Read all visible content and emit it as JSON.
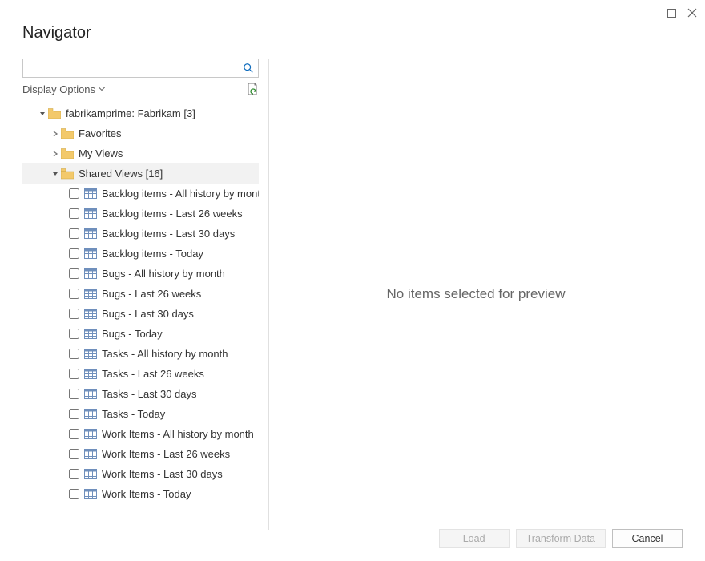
{
  "window": {
    "title": "Navigator"
  },
  "search": {
    "placeholder": ""
  },
  "options": {
    "display_label": "Display Options"
  },
  "tree": {
    "root": {
      "label": "fabrikamprime: Fabrikam [3]"
    },
    "favorites": {
      "label": "Favorites"
    },
    "my_views": {
      "label": "My Views"
    },
    "shared_views": {
      "label": "Shared Views [16]"
    },
    "items": [
      {
        "label": "Backlog items - All history by month"
      },
      {
        "label": "Backlog items - Last 26 weeks"
      },
      {
        "label": "Backlog items - Last 30 days"
      },
      {
        "label": "Backlog items - Today"
      },
      {
        "label": "Bugs - All history by month"
      },
      {
        "label": "Bugs - Last 26 weeks"
      },
      {
        "label": "Bugs - Last 30 days"
      },
      {
        "label": "Bugs - Today"
      },
      {
        "label": "Tasks - All history by month"
      },
      {
        "label": "Tasks - Last 26 weeks"
      },
      {
        "label": "Tasks - Last 30 days"
      },
      {
        "label": "Tasks - Today"
      },
      {
        "label": "Work Items - All history by month"
      },
      {
        "label": "Work Items - Last 26 weeks"
      },
      {
        "label": "Work Items - Last 30 days"
      },
      {
        "label": "Work Items - Today"
      }
    ]
  },
  "preview": {
    "empty_text": "No items selected for preview"
  },
  "footer": {
    "load": "Load",
    "transform": "Transform Data",
    "cancel": "Cancel"
  }
}
